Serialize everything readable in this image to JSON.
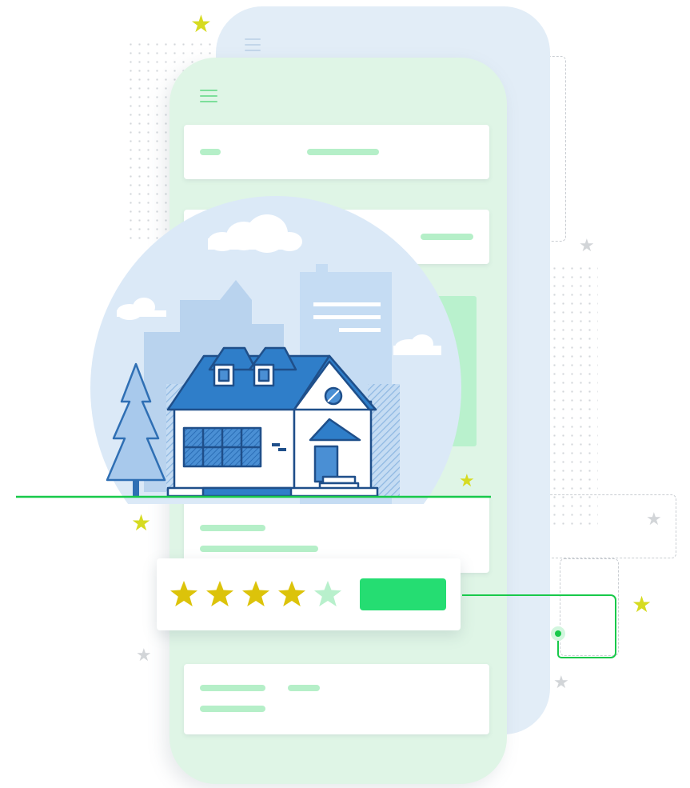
{
  "illustration": {
    "description_free": true,
    "rating": {
      "value": 4,
      "max": 5
    },
    "colors": {
      "accent_green": "#25dd72",
      "line_green": "#18c94a",
      "star_yellow": "#d6db21",
      "house_blue": "#2f7ec9",
      "phone_front": "#dff5e6",
      "phone_back": "#e2edf7"
    },
    "icons": [
      "menu-icon",
      "star-icon",
      "house-icon",
      "tree-icon",
      "cloud-icon"
    ]
  }
}
